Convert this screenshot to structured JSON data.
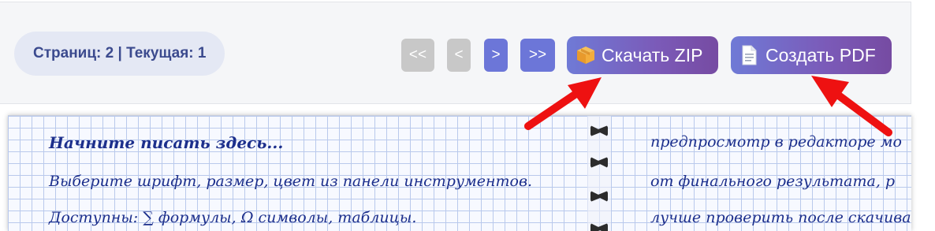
{
  "pagination": {
    "info": "Страниц: 2 | Текущая: 1",
    "first": "<<",
    "prev": "<",
    "next": ">",
    "last": ">>"
  },
  "actions": {
    "zip_label": "Скачать ZIP",
    "pdf_label": "Создать PDF",
    "zip_icon": "package-icon",
    "pdf_icon": "document-icon"
  },
  "notebook": {
    "left_lines": [
      "Начните писать здесь...",
      "Выберите шрифт, размер, цвет из панели инструментов.",
      "Доступны: ∑ формулы, Ω символы, таблицы."
    ],
    "right_lines": [
      "предпросмотр в редакторе мо",
      "от финального результата, р",
      "лучше проверить после скачива"
    ]
  },
  "colors": {
    "accent": "#6c76d8",
    "gradient_end": "#764ba2",
    "ink": "#1c2f8c",
    "arrow": "#ee1111"
  }
}
